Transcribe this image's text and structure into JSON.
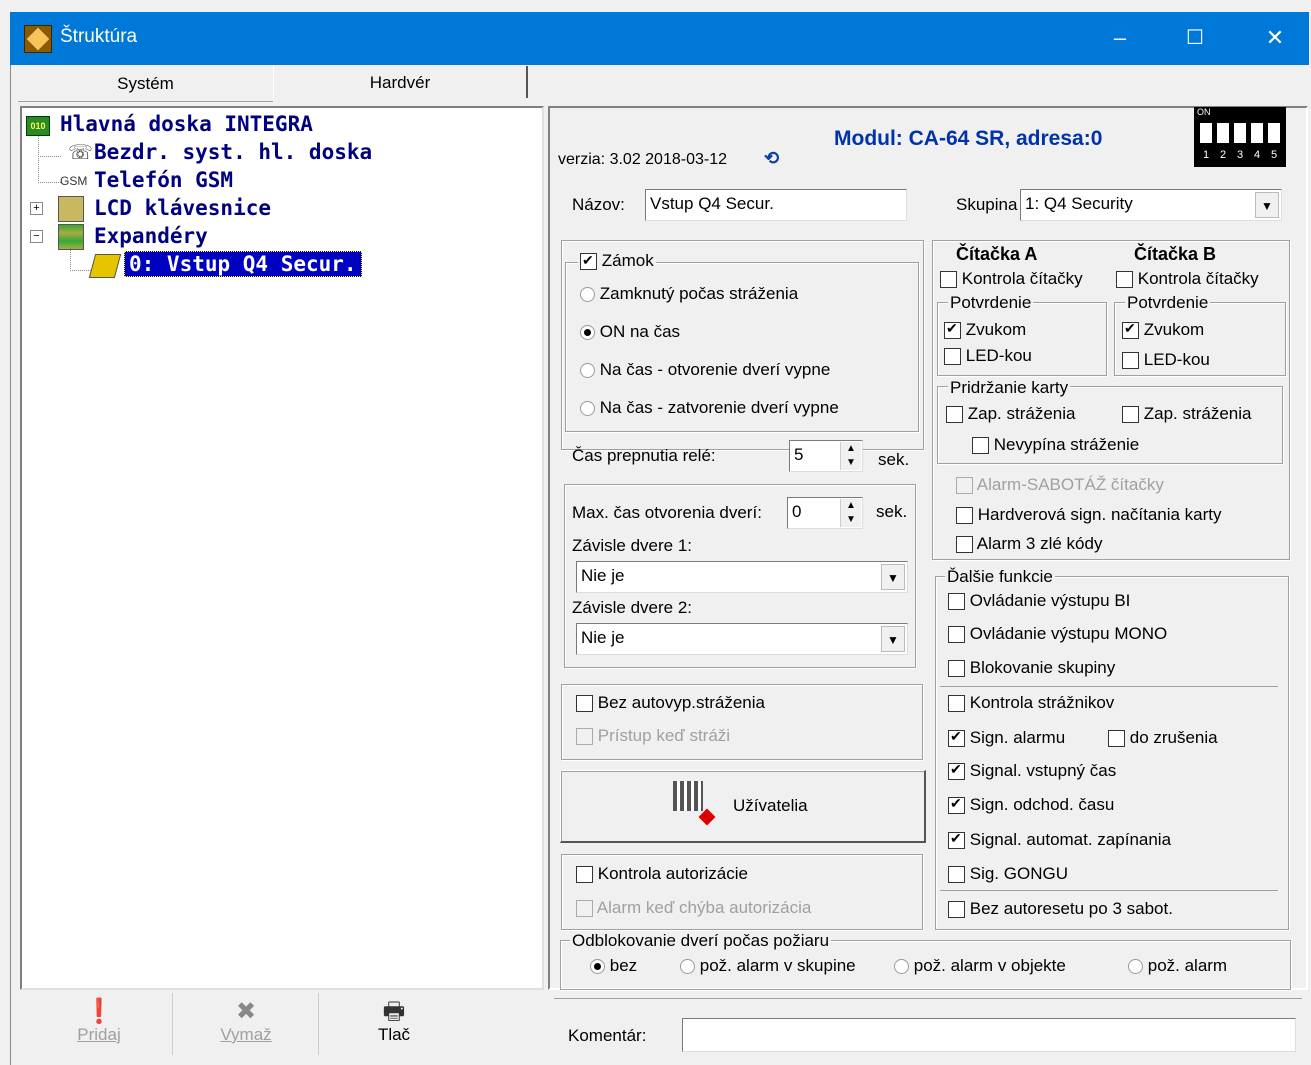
{
  "window": {
    "title": "Štruktúra",
    "min_glyph": "–",
    "max_glyph": "☐",
    "close_glyph": "✕"
  },
  "tabs": [
    "Systém",
    "Hardvér"
  ],
  "tree": {
    "root": "Hlavná doska INTEGRA",
    "root_icon_text": "010",
    "items": [
      "Bezdr. syst. hl. doska",
      "Telefón GSM",
      "LCD klávesnice",
      "Expandéry"
    ],
    "gsm_icon_text": "GSM",
    "selected": "0: Vstup Q4 Secur.",
    "expand_plus": "+",
    "expand_minus": "−"
  },
  "left_buttons": [
    {
      "label": "Pridaj",
      "icon": "exclamation-icon",
      "glyph": "❗"
    },
    {
      "label": "Vymaž",
      "icon": "delete-x-icon",
      "glyph": "✖"
    },
    {
      "label": "Tlač",
      "icon": "printer-icon",
      "glyph": "🖶"
    }
  ],
  "header": {
    "version": "verzia: 3.02 2018-03-12",
    "refresh_glyph": "⟲",
    "module": "Modul: CA-64 SR, adresa:0",
    "dip_on": "ON",
    "dip_numbers": [
      "1",
      "2",
      "3",
      "4",
      "5"
    ]
  },
  "name": {
    "label": "Názov:",
    "value": "Vstup Q4 Secur."
  },
  "group": {
    "label": "Skupina",
    "value": "1: Q4 Security"
  },
  "lock": {
    "label": "Zámok",
    "checked": true,
    "options": [
      "Zamknutý počas stráženia",
      "ON na čas",
      "Na čas - otvorenie dverí vypne",
      "Na čas - zatvorenie dverí vypne"
    ],
    "selected": 1
  },
  "relay": {
    "label": "Čas prepnutia relé:",
    "value": "5",
    "unit": "sek."
  },
  "door": {
    "max_label": "Max. čas otvorenia dverí:",
    "max_value": "0",
    "unit": "sek.",
    "dep1_label": "Závisle dvere 1:",
    "dep1_value": "Nie je",
    "dep2_label": "Závisle dvere 2:",
    "dep2_value": "Nie je"
  },
  "auto": {
    "bez_autovyp": "Bez autovyp.stráženia",
    "pristup": "Prístup keď stráži"
  },
  "users_button": "Užívatelia",
  "auth": {
    "kontrola": "Kontrola autorizácie",
    "alarm": "Alarm keď chýba autorizácia"
  },
  "readerA": {
    "title": "Čítačka A",
    "kontrola": "Kontrola čítačky",
    "potvrdenie": "Potvrdenie",
    "zvukom": "Zvukom",
    "led": "LED-kou"
  },
  "readerB": {
    "title": "Čítačka B",
    "kontrola": "Kontrola čítačky",
    "potvrdenie": "Potvrdenie",
    "zvukom": "Zvukom",
    "led": "LED-kou"
  },
  "hold": {
    "title": "Pridržanie karty",
    "zapA": "Zap. stráženia",
    "zapB": "Zap. stráženia",
    "nevypina": "Nevypína stráženie"
  },
  "reader_misc": {
    "sabotaz": "Alarm-SABOTÁŽ čítačky",
    "hardverova": "Hardverová sign. načítania karty",
    "alarm3": "Alarm 3 zlé kódy"
  },
  "more": {
    "title": "Ďalšie funkcie",
    "items": [
      "Ovládanie výstupu BI",
      "Ovládanie výstupu MONO",
      "Blokovanie skupiny",
      "Kontrola strážnikov",
      "Sign. alarmu",
      "Signal. vstupný čas",
      "Sign. odchod. času",
      "Signal. automat. zapínania",
      "Sig. GONGU",
      "Bez autoresetu po 3 sabot."
    ],
    "checked": [
      false,
      false,
      false,
      false,
      true,
      true,
      true,
      true,
      false,
      false
    ],
    "do_zrusenia": "do zrušenia"
  },
  "fire": {
    "title": "Odblokovanie dverí počas požiaru",
    "options": [
      "bez",
      "pož. alarm v skupine",
      "pož. alarm v objekte",
      "pož. alarm"
    ],
    "selected": 0
  },
  "comment": {
    "label": "Komentár:",
    "value": ""
  }
}
